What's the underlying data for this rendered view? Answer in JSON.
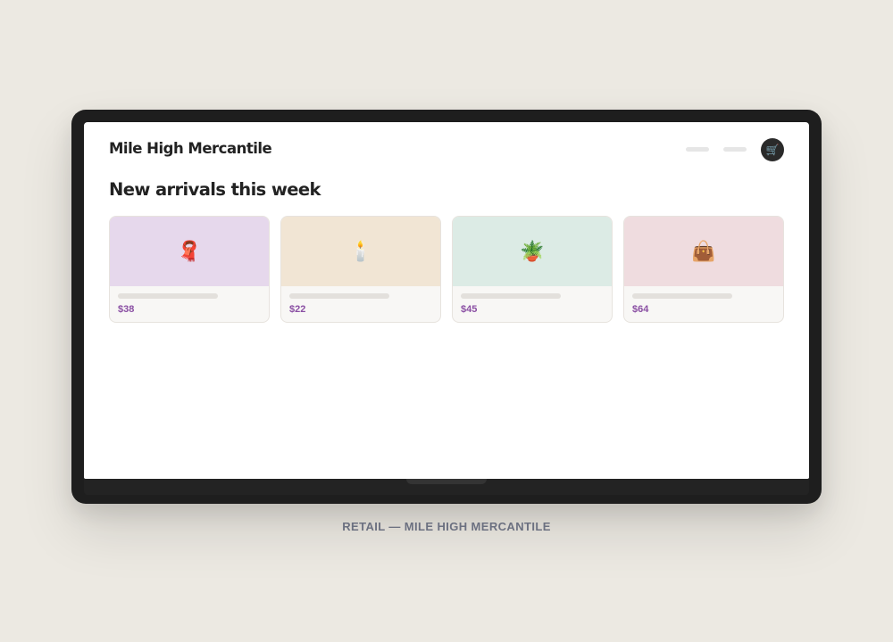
{
  "store": {
    "brand": "Mile High Mercantile",
    "cart_icon": "cart-icon",
    "cart_glyph": "🛒"
  },
  "main": {
    "heading": "New arrivals this week",
    "products": [
      {
        "icon": "scarf-icon",
        "glyph": "🧣",
        "price": "$38",
        "image_bg": "#e6d8ec"
      },
      {
        "icon": "candle-icon",
        "glyph": "🕯️",
        "price": "$22",
        "image_bg": "#f1e5d4"
      },
      {
        "icon": "potted-plant-icon",
        "glyph": "🪴",
        "price": "$45",
        "image_bg": "#dcebe5"
      },
      {
        "icon": "handbag-icon",
        "glyph": "👜",
        "price": "$64",
        "image_bg": "#efdcdf"
      }
    ]
  },
  "caption": "RETAIL — MILE HIGH MERCANTILE",
  "colors": {
    "accent_price": "#8a4fa3",
    "page_bg": "#ece9e2",
    "device": "#1e1e1e"
  }
}
